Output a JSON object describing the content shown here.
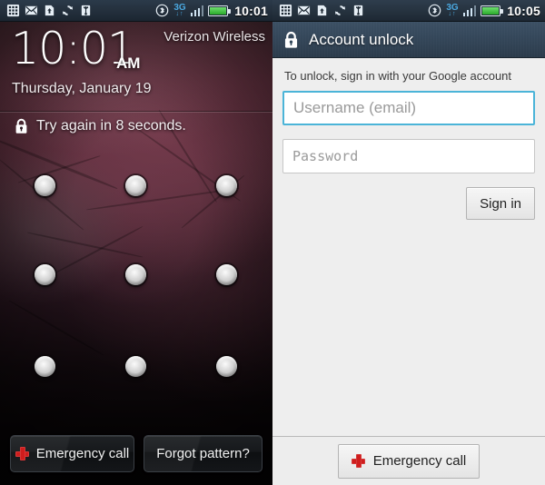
{
  "lockscreen": {
    "statusbar": {
      "icons": [
        "apps-grid-icon",
        "mail-icon",
        "sdcard-icon",
        "sync-icon",
        "usb-icon"
      ],
      "right_icons": [
        "bluetooth-icon",
        "3g-signal-icon",
        "signal-bars-icon",
        "battery-icon"
      ],
      "network_label": "3G",
      "network_sub": "↓↑",
      "clock": "10:01"
    },
    "carrier": "Verizon Wireless",
    "time": "10:01",
    "ampm": "AM",
    "date": "Thursday, January 19",
    "lockout_icon": "lock-icon",
    "lockout_message": "Try again in 8 seconds.",
    "pattern_grid": {
      "rows": 3,
      "cols": 3,
      "dot_count": 9
    },
    "buttons": {
      "emergency_call": "Emergency call",
      "emergency_icon": "red-cross-icon",
      "forgot_pattern": "Forgot pattern?"
    }
  },
  "unlock": {
    "statusbar": {
      "icons": [
        "apps-grid-icon",
        "mail-icon",
        "sdcard-icon",
        "sync-icon",
        "usb-icon"
      ],
      "right_icons": [
        "bluetooth-icon",
        "3g-signal-icon",
        "signal-bars-icon",
        "battery-icon"
      ],
      "network_label": "3G",
      "network_sub": "↓↑",
      "clock": "10:05"
    },
    "title": "Account unlock",
    "title_icon": "lock-icon",
    "hint": "To unlock, sign in with your Google account",
    "username_placeholder": "Username (email)",
    "username_value": "",
    "password_placeholder": "Password",
    "password_value": "",
    "sign_in_label": "Sign in",
    "emergency_call": "Emergency call",
    "emergency_icon": "red-cross-icon"
  },
  "colors": {
    "accent_focus": "#4bb4d8",
    "emergency_red": "#cf1d1d",
    "statusbar_bg": "#27333f",
    "titlebar_bg": "#35485b",
    "panel_bg": "#eeeeee",
    "battery_green": "#4cc44c",
    "network_blue": "#4aa8e0"
  }
}
